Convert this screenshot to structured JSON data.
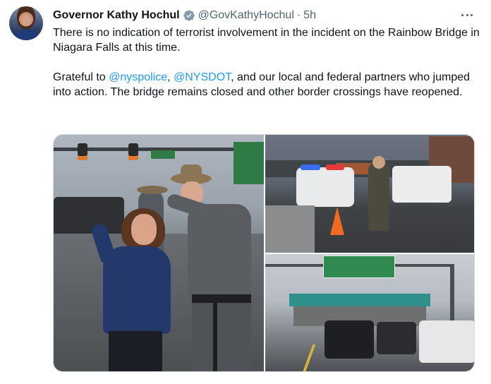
{
  "author": {
    "display_name": "Governor Kathy Hochul",
    "handle": "@GovKathyHochul",
    "separator": "·",
    "time": "5h",
    "verified_icon": "verified-badge-icon"
  },
  "tweet": {
    "line1": "There is no indication of terrorist involvement in the incident on the Rainbow Bridge in Niagara Falls at this time.",
    "p2_prefix": "Grateful to ",
    "mention1": "@nyspolice",
    "p2_mid": ", ",
    "mention2": "@NYSDOT",
    "p2_suffix": ", and our local and federal partners who jumped into action. The bridge remains closed and other border crossings have reopened."
  },
  "media": {
    "photo_count": 3
  },
  "colors": {
    "text": "#0f1419",
    "secondary": "#536471",
    "link": "#1d9bf0",
    "verified": "#829aab"
  }
}
